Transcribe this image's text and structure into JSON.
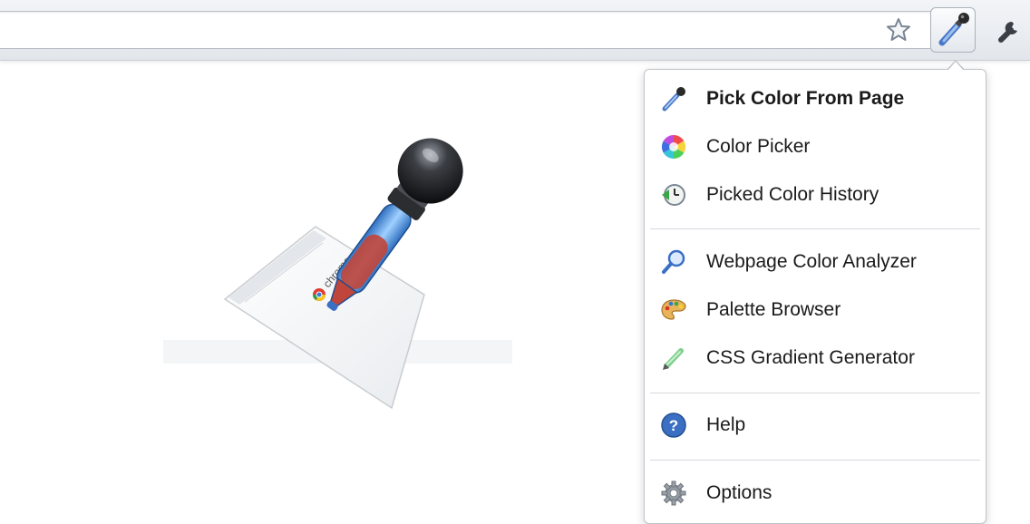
{
  "toolbar": {
    "star_icon": "star-icon",
    "extension_icon": "eyedropper-icon",
    "wrench_icon": "wrench-icon"
  },
  "illustration": {
    "browser_logo_text": "chrome"
  },
  "menu": {
    "items": [
      {
        "label": "Pick Color From Page",
        "icon": "eyedropper-icon",
        "bold": true
      },
      {
        "label": "Color Picker",
        "icon": "color-wheel-icon"
      },
      {
        "label": "Picked Color History",
        "icon": "history-clock-icon"
      },
      {
        "label": "Webpage Color Analyzer",
        "icon": "magnifier-icon"
      },
      {
        "label": "Palette Browser",
        "icon": "palette-icon"
      },
      {
        "label": "CSS Gradient Generator",
        "icon": "pen-icon"
      },
      {
        "label": "Help",
        "icon": "help-icon"
      },
      {
        "label": "Options",
        "icon": "gear-icon"
      }
    ]
  },
  "colors": {
    "accent_blue": "#3a6fc4",
    "history_green": "#3aa64a",
    "liquid_red": "#c0453a"
  }
}
